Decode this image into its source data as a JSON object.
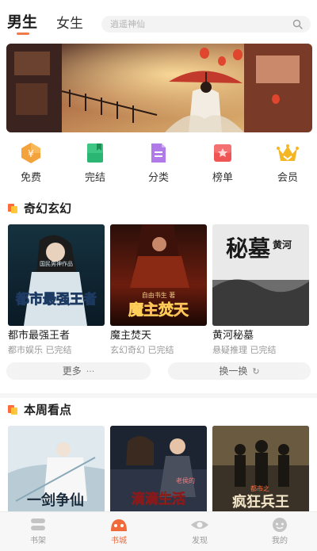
{
  "header": {
    "tabs": [
      {
        "label": "男生",
        "active": true
      },
      {
        "label": "女生",
        "active": false
      }
    ],
    "search": {
      "placeholder": "逍遥神仙"
    }
  },
  "categories": [
    {
      "label": "免费",
      "icon": "yuan-tag-icon",
      "color": "#f4a33c"
    },
    {
      "label": "完结",
      "icon": "book-bookmark-icon",
      "color": "#2bb673"
    },
    {
      "label": "分类",
      "icon": "document-list-icon",
      "color": "#b07be8"
    },
    {
      "label": "榜单",
      "icon": "ranking-flag-icon",
      "color": "#f05555"
    },
    {
      "label": "会员",
      "icon": "crown-icon",
      "color": "#f5b623"
    }
  ],
  "sections": [
    {
      "title": "奇幻玄幻",
      "books": [
        {
          "title": "都市最强王者",
          "meta": "都市娱乐 已完结",
          "cover_text": "都市最强王者",
          "cover_sub": "国民男神作品"
        },
        {
          "title": "魔主焚天",
          "meta": "玄幻奇幻 已完结",
          "cover_text": "魔主焚天",
          "cover_sub": "自由书生 著"
        },
        {
          "title": "黄河秘墓",
          "meta": "悬疑推理 已完结",
          "cover_text": "秘墓",
          "cover_sub": "黄河"
        }
      ],
      "more_label": "更多",
      "more_glyph": "···",
      "refresh_label": "换一换",
      "refresh_glyph": "↻"
    },
    {
      "title": "本周看点",
      "books": [
        {
          "cover_text": "一剑争仙"
        },
        {
          "cover_text": "滴滴生活",
          "cover_sub": "老侯的"
        },
        {
          "cover_text": "疯狂兵王",
          "cover_sub": "都市之"
        }
      ]
    }
  ],
  "bottom_nav": [
    {
      "label": "书架",
      "icon": "bookshelf-icon",
      "active": false
    },
    {
      "label": "书城",
      "icon": "bookstore-icon",
      "active": true
    },
    {
      "label": "发现",
      "icon": "eye-discover-icon",
      "active": false
    },
    {
      "label": "我的",
      "icon": "profile-face-icon",
      "active": false
    }
  ],
  "colors": {
    "accent": "#f06a3a",
    "inactive": "#bdbdbd"
  }
}
